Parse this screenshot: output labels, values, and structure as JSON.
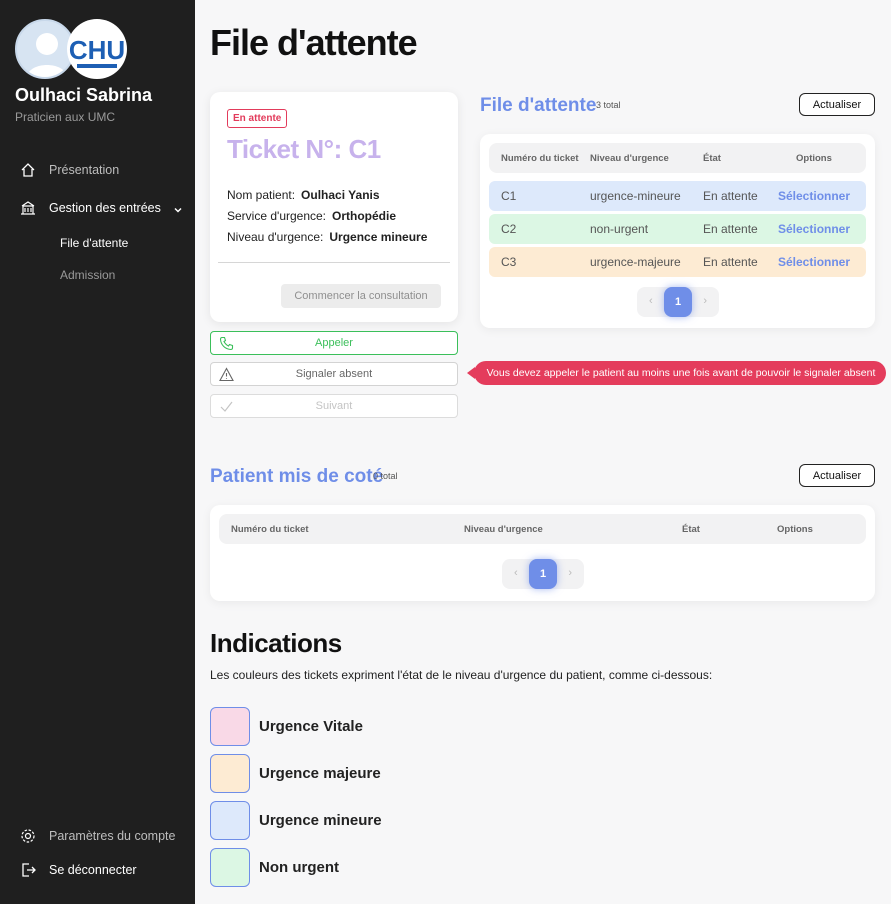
{
  "sidebar": {
    "user_name": "Oulhaci Sabrina",
    "user_role": "Praticien aux UMC",
    "nav": {
      "presentation": "Présentation",
      "entries": "Gestion des entrées",
      "queue": "File d'attente",
      "admission": "Admission",
      "settings": "Paramètres du compte",
      "logout": "Se déconnecter"
    }
  },
  "page_title": "File d'attente",
  "ticket": {
    "status_badge": "En attente",
    "title": "Ticket N°: C1",
    "patient_label": "Nom patient:",
    "patient_value": "Oulhaci Yanis",
    "service_label": "Service d'urgence:",
    "service_value": "Orthopédie",
    "level_label": "Niveau d'urgence:",
    "level_value": "Urgence mineure",
    "consult_button": "Commencer la consultation"
  },
  "actions": {
    "call": "Appeler",
    "absent": "Signaler absent",
    "next": "Suivant"
  },
  "tooltip": "Vous devez appeler le patient au moins une fois avant de pouvoir le signaler absent",
  "queue": {
    "title": "File d'attente",
    "count": "3 total",
    "refresh": "Actualiser",
    "headers": [
      "Numéro du ticket",
      "Niveau d'urgence",
      "État",
      "Options"
    ],
    "rows": [
      {
        "ticket": "C1",
        "level": "urgence-mineure",
        "state": "En attente",
        "option": "Sélectionner",
        "color": "#dde9fb"
      },
      {
        "ticket": "C2",
        "level": "non-urgent",
        "state": "En attente",
        "option": "Sélectionner",
        "color": "#dcf7e4"
      },
      {
        "ticket": "C3",
        "level": "urgence-majeure",
        "state": "En attente",
        "option": "Sélectionner",
        "color": "#fdebd3"
      }
    ],
    "page": "1"
  },
  "aside": {
    "title": "Patient mis de coté",
    "count": "0 total",
    "refresh": "Actualiser",
    "headers": [
      "Numéro du ticket",
      "Niveau d'urgence",
      "État",
      "Options"
    ],
    "page": "1"
  },
  "indications": {
    "title": "Indications",
    "description": "Les couleurs des tickets expriment l'état de le niveau d'urgence du patient, comme ci-dessous:",
    "legend": [
      {
        "label": "Urgence Vitale",
        "color": "#f9d9e7"
      },
      {
        "label": "Urgence majeure",
        "color": "#fdebd3"
      },
      {
        "label": "Urgence mineure",
        "color": "#dde9fb"
      },
      {
        "label": "Non urgent",
        "color": "#dcf7e4"
      }
    ]
  },
  "colors": {
    "accent": "#6f8ee8",
    "danger": "#e43c5c",
    "success": "#3bbf5a",
    "sidebar_bg": "#1f1f1f"
  }
}
